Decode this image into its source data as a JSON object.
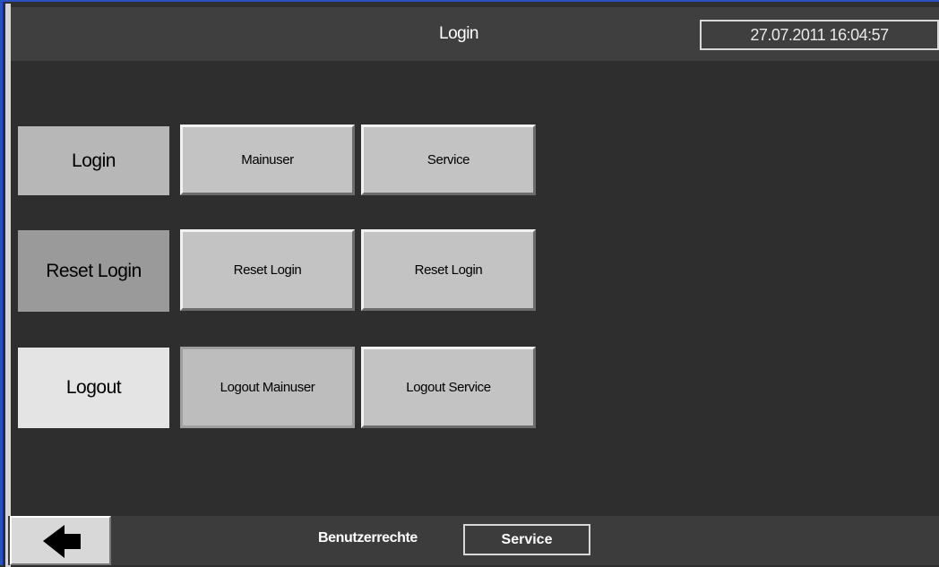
{
  "header": {
    "title": "Login",
    "datetime": "27.07.2011 16:04:57"
  },
  "rows": {
    "login": {
      "label": "Login",
      "buttons": [
        "Mainuser",
        "Service"
      ]
    },
    "reset": {
      "label": "Reset Login",
      "buttons": [
        "Reset Login",
        "Reset Login"
      ]
    },
    "logout": {
      "label": "Logout",
      "buttons": [
        "Logout Mainuser",
        "Logout Service"
      ]
    }
  },
  "footer": {
    "back_icon": "back-arrow-icon",
    "rights_label": "Benutzerrechte",
    "rights_value": "Service"
  },
  "colors": {
    "background": "#2e2e2e",
    "header": "#3f3f3f",
    "button": "#c3c3c3",
    "login_label_bg": "#b7b7b7",
    "reset_label_bg": "#9a9a9a",
    "logout_label_bg": "#e4e4e4",
    "accent_border": "#2a4fbf"
  }
}
